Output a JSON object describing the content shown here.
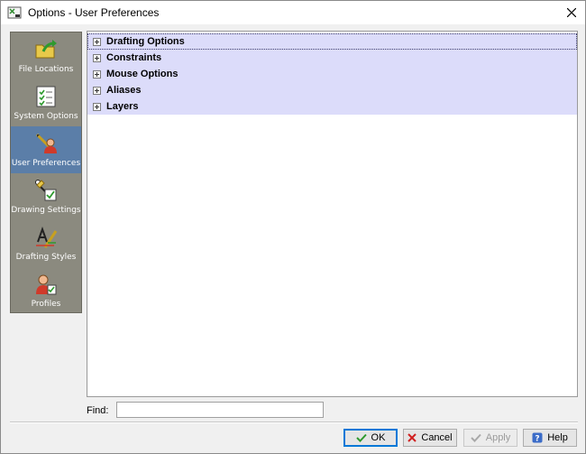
{
  "window": {
    "title": "Options - User Preferences",
    "app_icon": "options-app-icon",
    "close_icon": "close-icon"
  },
  "sidebar": {
    "items": [
      {
        "label": "File Locations",
        "icon": "folder-arrow-icon",
        "selected": false
      },
      {
        "label": "System Options",
        "icon": "checklist-icon",
        "selected": false
      },
      {
        "label": "User Preferences",
        "icon": "user-pencil-icon",
        "selected": true
      },
      {
        "label": "Drawing Settings",
        "icon": "drawing-settings-icon",
        "selected": false
      },
      {
        "label": "Drafting Styles",
        "icon": "drafting-styles-icon",
        "selected": false
      },
      {
        "label": "Profiles",
        "icon": "profile-icon",
        "selected": false
      }
    ]
  },
  "tree": {
    "items": [
      {
        "label": "Drafting Options",
        "expander": "+",
        "focused": true
      },
      {
        "label": "Constraints",
        "expander": "+"
      },
      {
        "label": "Mouse Options",
        "expander": "+"
      },
      {
        "label": "Aliases",
        "expander": "+"
      },
      {
        "label": "Layers",
        "expander": "+"
      }
    ],
    "row_color": "#dcdcfa"
  },
  "find": {
    "label": "Find:",
    "value": "",
    "placeholder": ""
  },
  "buttons": {
    "ok": {
      "label": "OK",
      "icon": "check-icon"
    },
    "cancel": {
      "label": "Cancel",
      "icon": "x-icon"
    },
    "apply": {
      "label": "Apply",
      "icon": "check-icon",
      "disabled": true
    },
    "help": {
      "label": "Help",
      "icon": "help-icon"
    }
  },
  "colors": {
    "sidebar_bg": "#8b8a7f",
    "sidebar_selected": "#5b7ea8",
    "ok_check": "#2e9a2e",
    "cancel_x": "#d02020",
    "help_blue": "#3b6cc8"
  }
}
